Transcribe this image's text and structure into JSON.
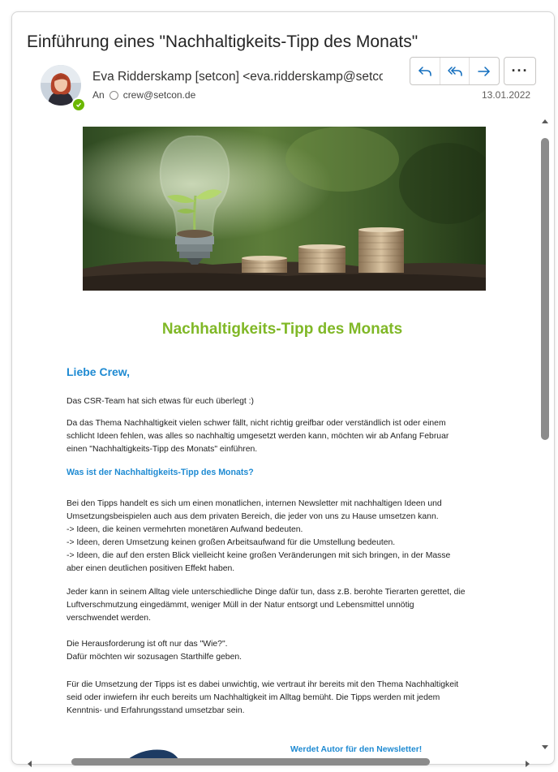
{
  "email": {
    "subject": "Einführung eines \"Nachhaltigkeits-Tipp des Monats\"",
    "sender": "Eva Ridderskamp [setcon] <eva.ridderskamp@setcon.de>",
    "to_label": "An",
    "recipient": "crew@setcon.de",
    "date": "13.01.2022"
  },
  "actions": {
    "reply": "reply-icon",
    "reply_all": "reply-all-icon",
    "forward": "forward-icon",
    "more": "···"
  },
  "body": {
    "newsletter_title": "Nachhaltigkeits-Tipp des Monats",
    "greeting": "Liebe Crew,",
    "intro": "Das CSR-Team hat sich etwas für euch überlegt :)",
    "para1": [
      "Da das Thema Nachhaltigkeit vielen schwer fällt, nicht richtig greifbar oder verständlich ist oder einem",
      "schlicht Ideen fehlen, was alles so nachhaltig umgesetzt werden kann, möchten wir ab Anfang Februar",
      "einen \"Nachhaltigkeits-Tipp des Monats\" einführen."
    ],
    "section_heading": "Was ist der Nachhaltigkeits-Tipp des Monats?",
    "para2": [
      "Bei den Tipps handelt es sich um einen monatlichen, internen Newsletter mit nachhaltigen Ideen und",
      "Umsetzungsbeispielen auch aus dem privaten Bereich, die jeder von uns zu Hause umsetzen kann.",
      "-> Ideen, die keinen vermehrten monetären Aufwand bedeuten.",
      "-> Ideen, deren Umsetzung keinen großen Arbeitsaufwand für die Umstellung bedeuten.",
      "-> Ideen, die auf den ersten Blick vielleicht keine großen Veränderungen mit sich bringen, in der Masse",
      "aber einen deutlichen positiven Effekt haben."
    ],
    "para3": [
      "Jeder kann in seinem Alltag viele unterschiedliche Dinge dafür tun, dass z.B. berohte Tierarten gerettet, die",
      "Luftverschmutzung eingedämmt, weniger Müll in der Natur entsorgt und Lebensmittel unnötig",
      "verschwendet werden."
    ],
    "para4": [
      "Die Herausforderung ist oft nur das \"Wie?\".",
      "Dafür möchten wir sozusagen Starthilfe geben."
    ],
    "para5": [
      "Für die Umsetzung der Tipps ist es dabei unwichtig, wie vertraut ihr bereits mit den Thema Nachhaltigkeit",
      "seid oder inwiefern ihr euch bereits um Nachhaltigkeit im Alltag bemüht. Die Tipps werden mit jedem",
      "Kenntnis- und Erfahrungsstand umsetzbar sein."
    ],
    "author_cta": "Werdet Autor für den Newsletter!"
  },
  "colors": {
    "accent_blue": "#1e8ad2",
    "title_green": "#80b827",
    "presence_green": "#6bb700",
    "action_blue": "#0f6cbd"
  }
}
